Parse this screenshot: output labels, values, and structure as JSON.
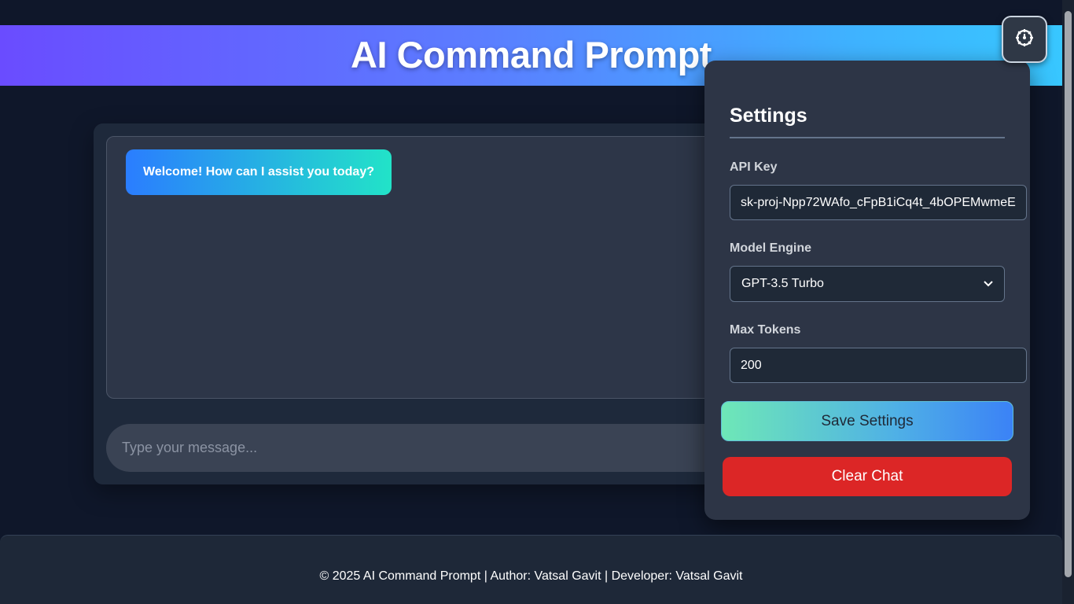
{
  "header": {
    "title": "AI Command Prompt"
  },
  "chat": {
    "welcome_message": "Welcome! How can I assist you today?",
    "input_placeholder": "Type your message..."
  },
  "settings": {
    "title": "Settings",
    "api_key_label": "API Key",
    "api_key_value": "sk-proj-Npp72WAfo_cFpB1iCq4t_4bOPEMwmeE",
    "model_label": "Model Engine",
    "model_value": "GPT-3.5 Turbo",
    "max_tokens_label": "Max Tokens",
    "max_tokens_value": "200",
    "save_label": "Save Settings",
    "clear_label": "Clear Chat",
    "toggle_icon": "gear-icon"
  },
  "footer": {
    "text": "© 2025 AI Command Prompt | Author: Vatsal Gavit | Developer: Vatsal Gavit"
  },
  "colors": {
    "background": "#0f172a",
    "danger": "#dc2626",
    "accent": "#3b82f6"
  }
}
